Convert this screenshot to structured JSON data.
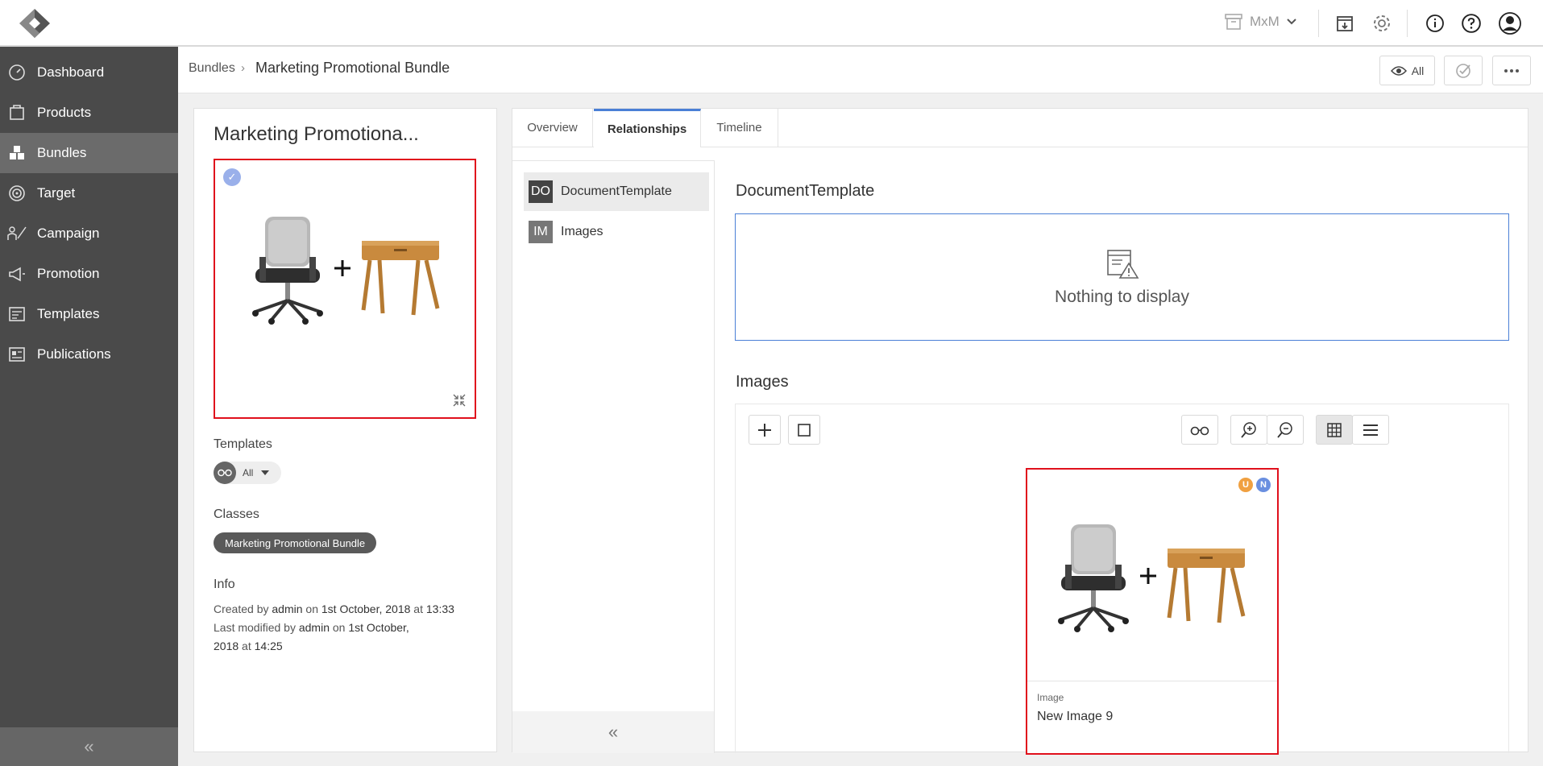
{
  "topbar": {
    "archive_label": "MxM",
    "icons": [
      "logo-icon",
      "archive-icon",
      "chevron-down-icon",
      "export-icon",
      "gear-icon",
      "info-icon",
      "help-icon",
      "user-icon"
    ]
  },
  "sidebar": {
    "items": [
      {
        "label": "Dashboard",
        "icon": "dashboard-icon"
      },
      {
        "label": "Products",
        "icon": "products-icon"
      },
      {
        "label": "Bundles",
        "icon": "bundles-icon"
      },
      {
        "label": "Target",
        "icon": "target-icon"
      },
      {
        "label": "Campaign",
        "icon": "campaign-icon"
      },
      {
        "label": "Promotion",
        "icon": "promotion-icon"
      },
      {
        "label": "Templates",
        "icon": "templates-icon"
      },
      {
        "label": "Publications",
        "icon": "publications-icon"
      }
    ],
    "active": "Bundles",
    "collapse_glyph": "«"
  },
  "breadcrumb": {
    "root": "Bundles",
    "separator": "›",
    "current": "Marketing Promotional Bundle"
  },
  "header_actions": {
    "view_label": "All"
  },
  "detail": {
    "title": "Marketing Promotiona...",
    "templates_label": "Templates",
    "templates_filter": "All",
    "classes_label": "Classes",
    "class_value": "Marketing Promotional Bundle",
    "info_label": "Info",
    "created_prefix": "Created by",
    "created_by": "admin",
    "created_on_word": "on",
    "created_date": "1st October, 2018",
    "created_at_word": "at",
    "created_time": "13:33",
    "modified_prefix": "Last modified by",
    "modified_by": "admin",
    "modified_on_word": "on",
    "modified_date_1": "1st October,",
    "modified_date_2": "2018",
    "modified_at_word": "at",
    "modified_time": "14:25"
  },
  "tabs": [
    {
      "label": "Overview"
    },
    {
      "label": "Relationships"
    },
    {
      "label": "Timeline"
    }
  ],
  "active_tab": "Relationships",
  "relationships": [
    {
      "abbr": "DO",
      "label": "DocumentTemplate"
    },
    {
      "abbr": "IM",
      "label": "Images"
    }
  ],
  "collapse_glyph": "«",
  "document_section": {
    "heading": "DocumentTemplate",
    "empty_text": "Nothing to display"
  },
  "images_section": {
    "heading": "Images",
    "view_mode": "grid",
    "card": {
      "type": "Image",
      "name": "New Image 9",
      "badges": [
        {
          "letter": "U",
          "color": "#f0a040"
        },
        {
          "letter": "N",
          "color": "#6a8fe0"
        }
      ]
    }
  },
  "colors": {
    "accent": "#4a7fd6",
    "highlight": "#e0101c",
    "sidebar": "#4a4a4a",
    "sidebar_active": "#6b6b6b"
  }
}
